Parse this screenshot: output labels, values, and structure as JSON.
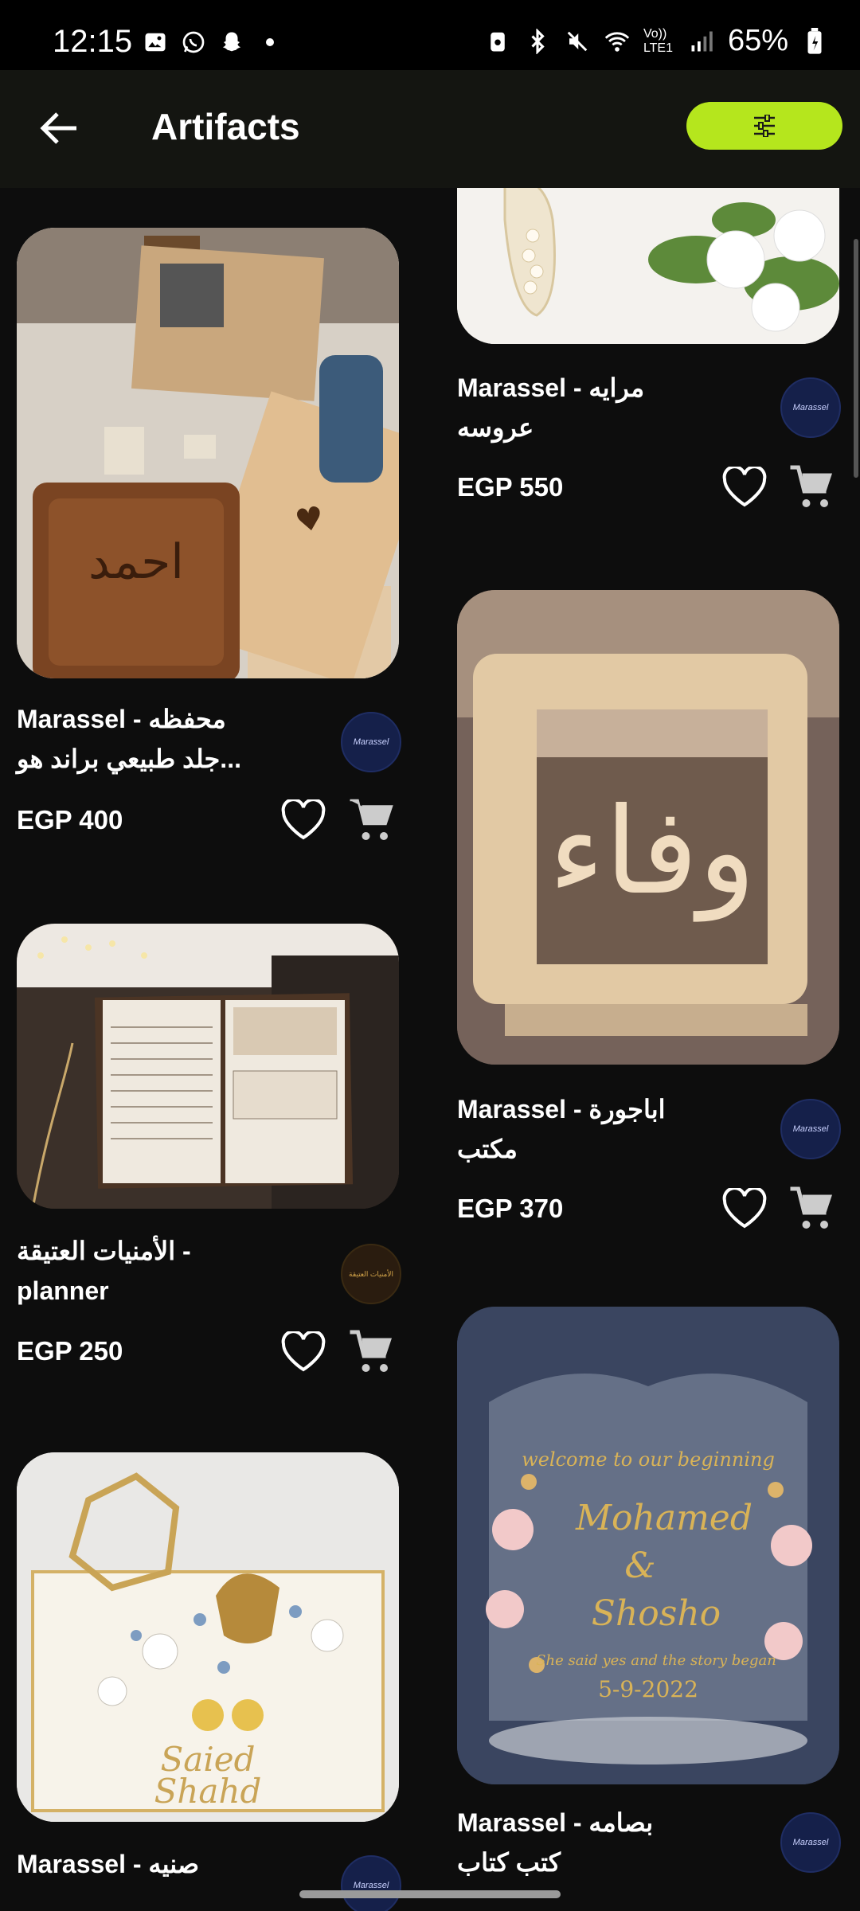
{
  "status_bar": {
    "time": "12:15",
    "network": "Vo)) LTE1",
    "battery": "65%"
  },
  "app_bar": {
    "title": "Artifacts",
    "accent": "#b5e61d"
  },
  "products": [
    {
      "title_line1": "Marassel - محفظه",
      "title_line2": "جلد طبيعي براند هو...",
      "price": "EGP 400",
      "seller": "Marassel"
    },
    {
      "title_line1": "الأمنيات العتيقة  -",
      "title_line2": "planner",
      "price": "EGP 250",
      "seller": "الأمنيات العتيقة"
    },
    {
      "title_line1": "Marassel - صنيه",
      "title_line2": "",
      "price": "",
      "seller": "Marassel"
    },
    {
      "title_line1": "Marassel - مرايه",
      "title_line2": "عروسه",
      "price": "EGP 550",
      "seller": "Marassel"
    },
    {
      "title_line1": "Marassel - اباجورة",
      "title_line2": "مكتب",
      "price": "EGP 370",
      "seller": "Marassel"
    },
    {
      "title_line1": "Marassel - بصامه",
      "title_line2": "كتب كتاب",
      "price": "",
      "seller": "Marassel"
    }
  ],
  "image_text": {
    "wallet": "احمد",
    "lamp": "وفاء",
    "plaque_top": "welcome to our beginning",
    "plaque_name1": "Mohamed",
    "plaque_amp": "&",
    "plaque_name2": "Shosho",
    "plaque_tagline": "She said yes and the story began",
    "plaque_date": "5-9-2022",
    "tray_name1": "Saied",
    "tray_name2": "Shahd"
  }
}
